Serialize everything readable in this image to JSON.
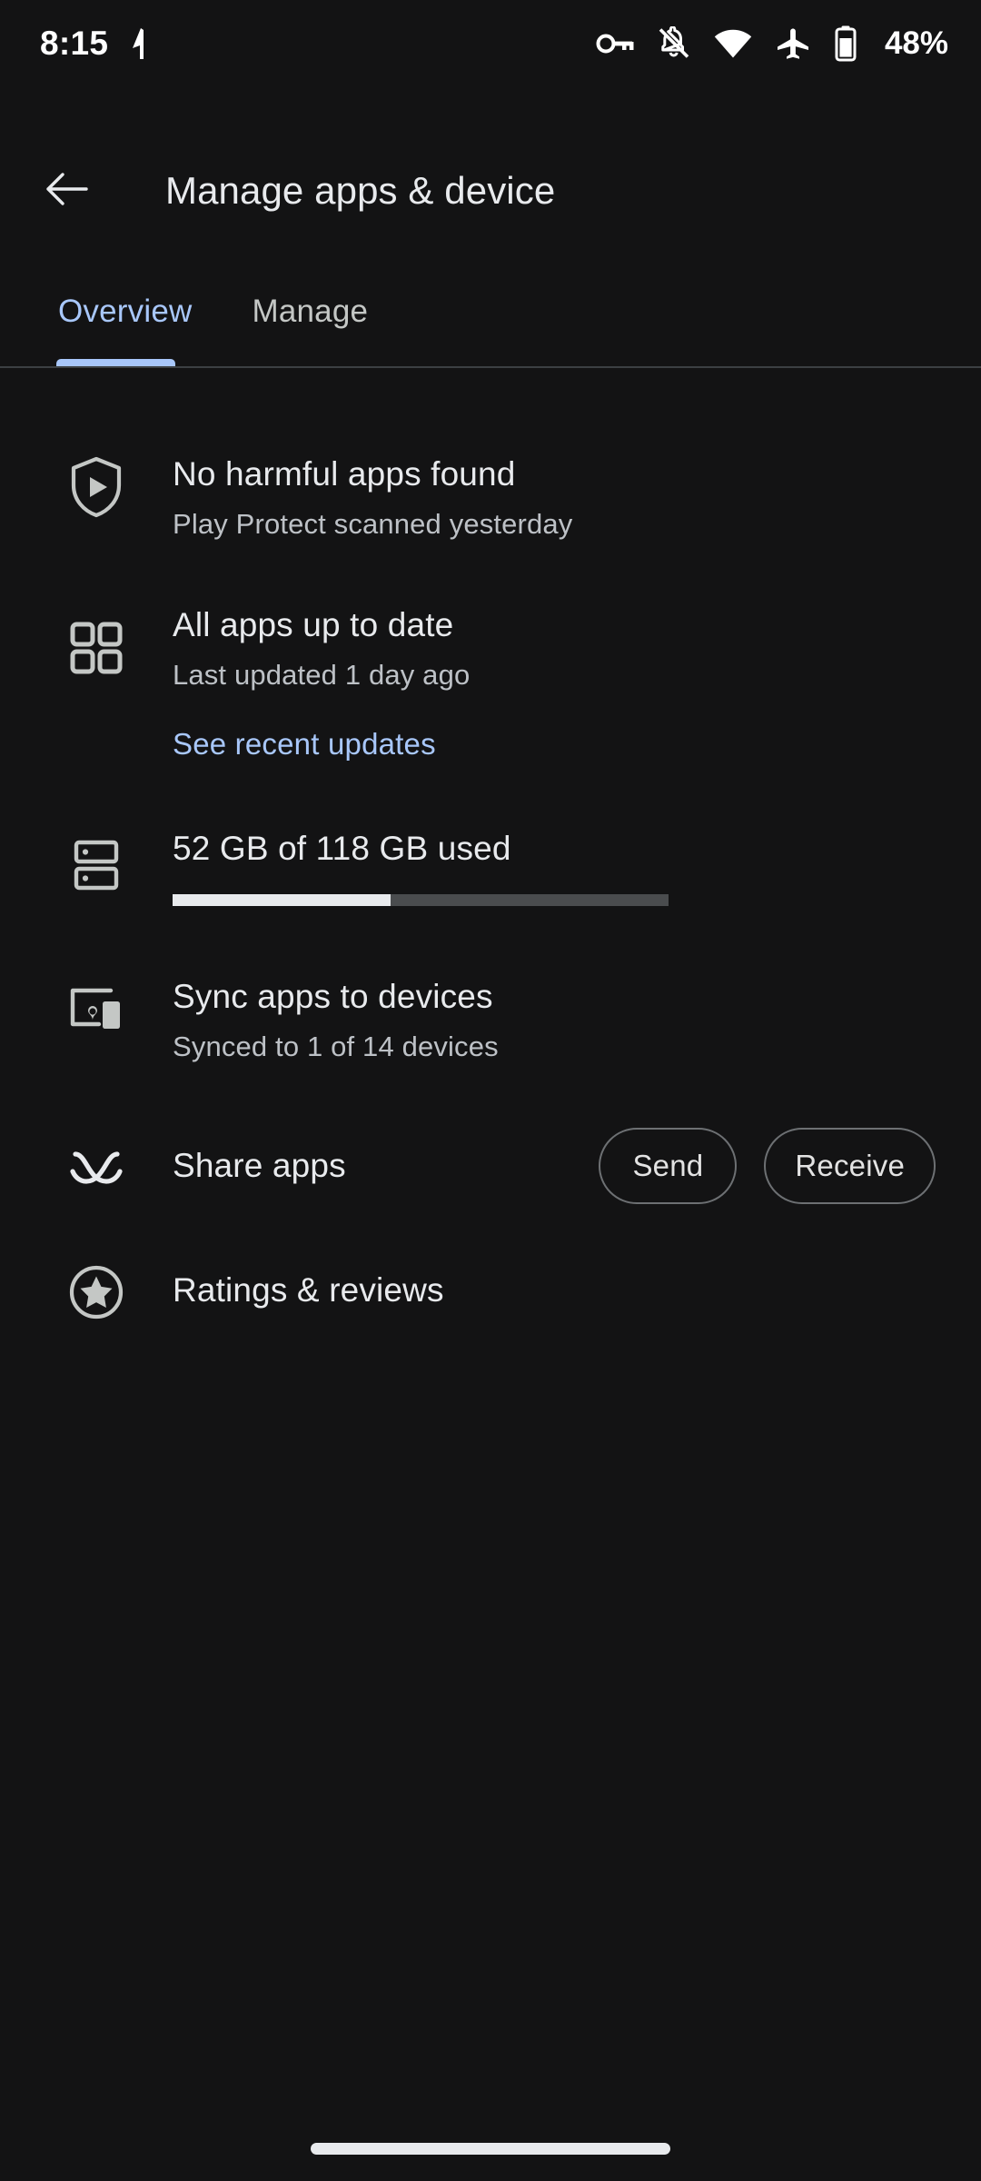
{
  "status_bar": {
    "time": "8:15",
    "battery_percent": "48%",
    "left_icons": [
      "location-arrow-icon"
    ],
    "right_icons": [
      "vpn-key-icon",
      "notifications-off-icon",
      "wifi-icon",
      "airplane-mode-icon",
      "battery-icon"
    ]
  },
  "app_bar": {
    "back_label": "back-arrow-icon",
    "title": "Manage apps & device"
  },
  "tabs": [
    {
      "label": "Overview",
      "active": true
    },
    {
      "label": "Manage",
      "active": false
    }
  ],
  "rows": {
    "play_protect": {
      "icon": "shield-play-icon",
      "title": "No harmful apps found",
      "subtitle": "Play Protect scanned yesterday"
    },
    "updates": {
      "icon": "apps-grid-icon",
      "title": "All apps up to date",
      "subtitle": "Last updated 1 day ago",
      "link": "See recent updates"
    },
    "storage": {
      "icon": "storage-icon",
      "title": "52 GB of 118 GB used",
      "used_gb": 52,
      "total_gb": 118,
      "fill_percent": 44
    },
    "sync": {
      "icon": "devices-icon",
      "title": "Sync apps to devices",
      "subtitle": "Synced to 1 of 14 devices"
    },
    "share": {
      "icon": "nearby-share-icon",
      "title": "Share apps",
      "send_label": "Send",
      "receive_label": "Receive"
    },
    "ratings": {
      "icon": "star-circle-icon",
      "title": "Ratings & reviews"
    }
  },
  "colors": {
    "background": "#131314",
    "accent": "#a8c7fa",
    "primary_text": "#e8eaed",
    "secondary_text": "#bdc1c6"
  }
}
